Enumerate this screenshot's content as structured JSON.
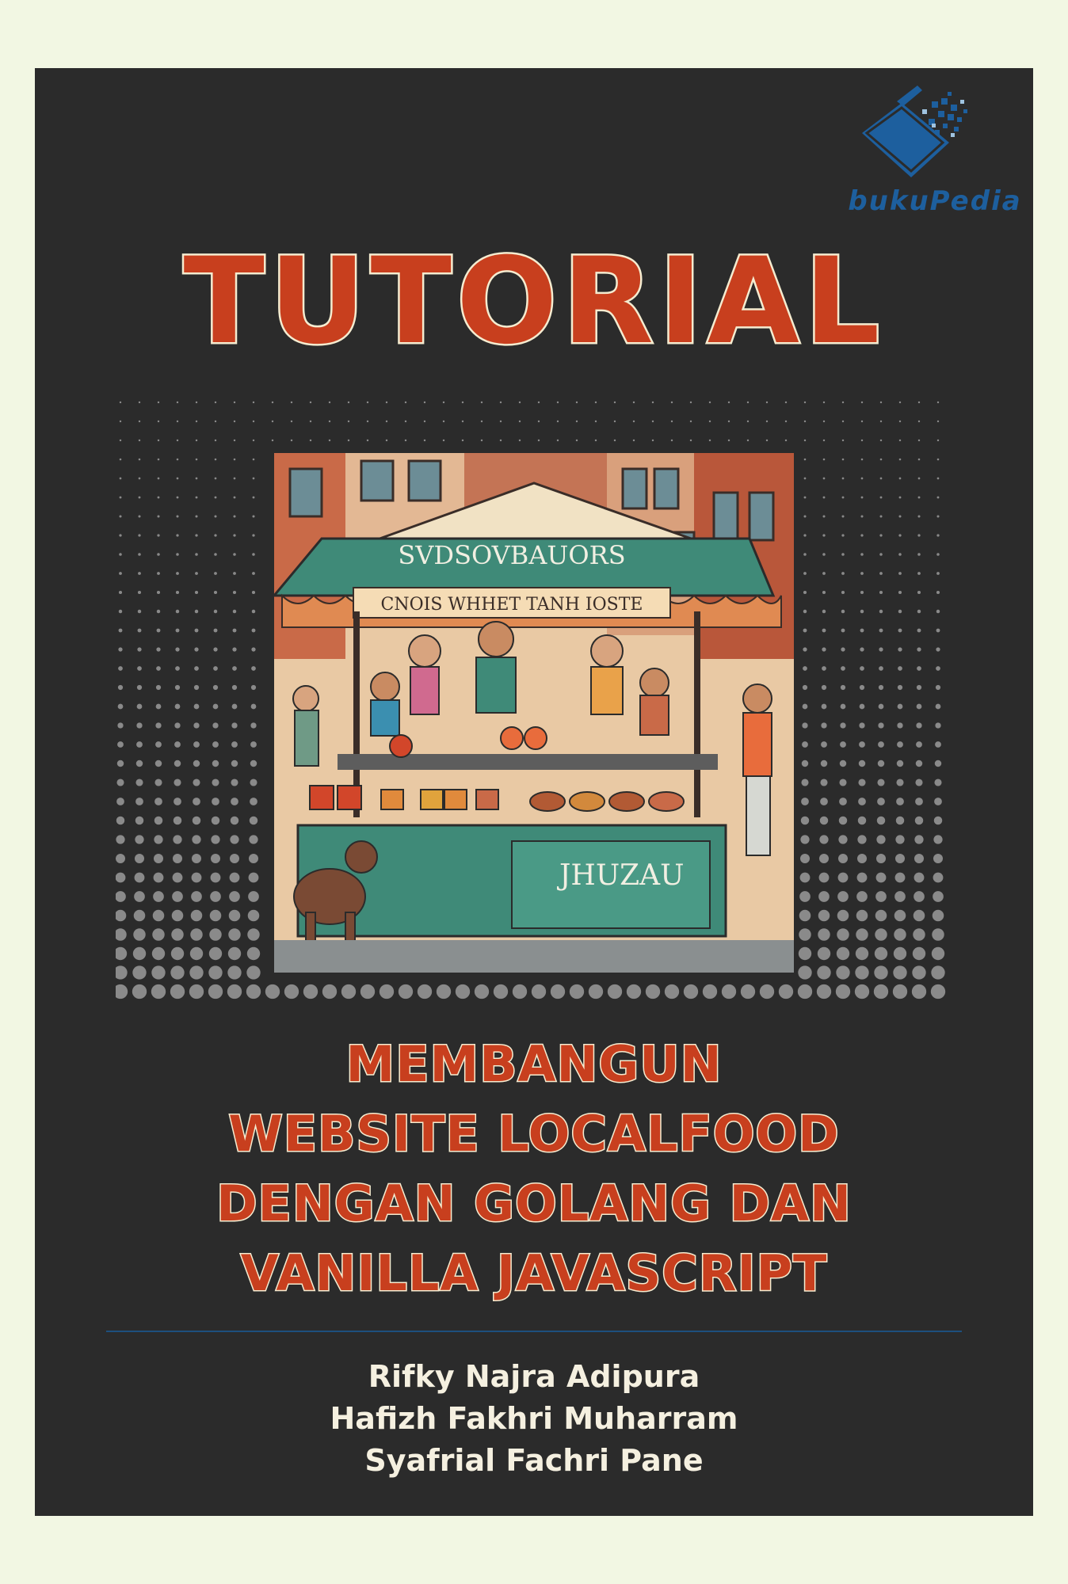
{
  "publisher": {
    "logo_text": "bukuPedia",
    "icon": "book-pixel-icon",
    "color": "#1d5f9e"
  },
  "title": "TUTORIAL",
  "subtitle_lines": [
    "MEMBANGUN",
    "WEBSITE LOCALFOOD",
    "DENGAN GOLANG DAN",
    "VANILLA JAVASCRIPT"
  ],
  "illustration": {
    "sign_top": "SVDSOVBAUORS",
    "sign_bottom": "CNOIS   WHHET TANH IOSTE",
    "counter_text": "JHUZAU"
  },
  "authors": [
    "Rifky Najra Adipura",
    "Hafizh Fakhri Muharram",
    "Syafrial Fachri Pane"
  ],
  "colors": {
    "background": "#f2f7e3",
    "cover": "#2b2b2b",
    "accent": "#c83f1e",
    "outline": "#f5ecd0",
    "divider": "#1d4f7e"
  }
}
